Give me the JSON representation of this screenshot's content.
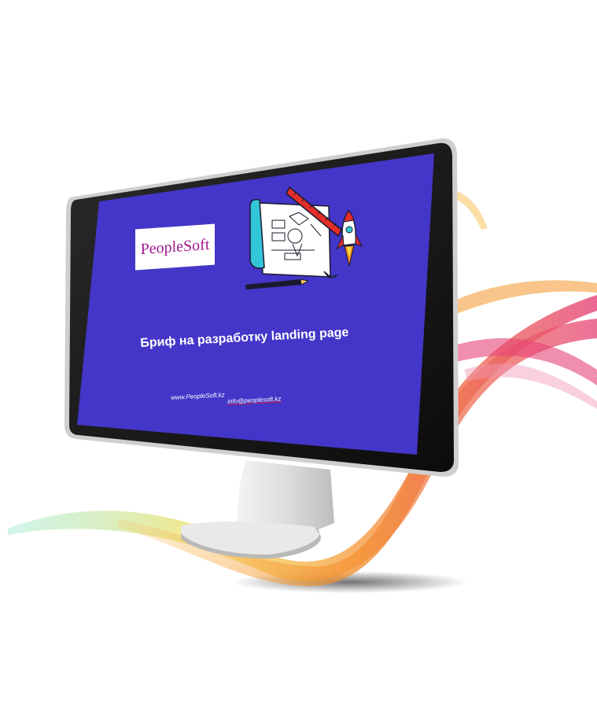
{
  "screen": {
    "background_color": "#4436c8",
    "logo_text": "PeopleSoft",
    "title": "Бриф на разработку landing page",
    "website": "www.PeopleSoft.kz",
    "email": "info@peoplesoft.kz"
  },
  "colors": {
    "logo_magenta": "#a01990",
    "accent_red": "#e42e2a",
    "accent_cyan": "#33c6d8",
    "swoosh_orange": "#f38a23",
    "swoosh_pink": "#e4326b",
    "swoosh_yellow": "#f6dc43"
  },
  "icons": {
    "illustration": "blueprint-rocket-illustration-icon",
    "ruler": "ruler-icon",
    "pencil": "pencil-icon",
    "rocket": "rocket-icon"
  }
}
